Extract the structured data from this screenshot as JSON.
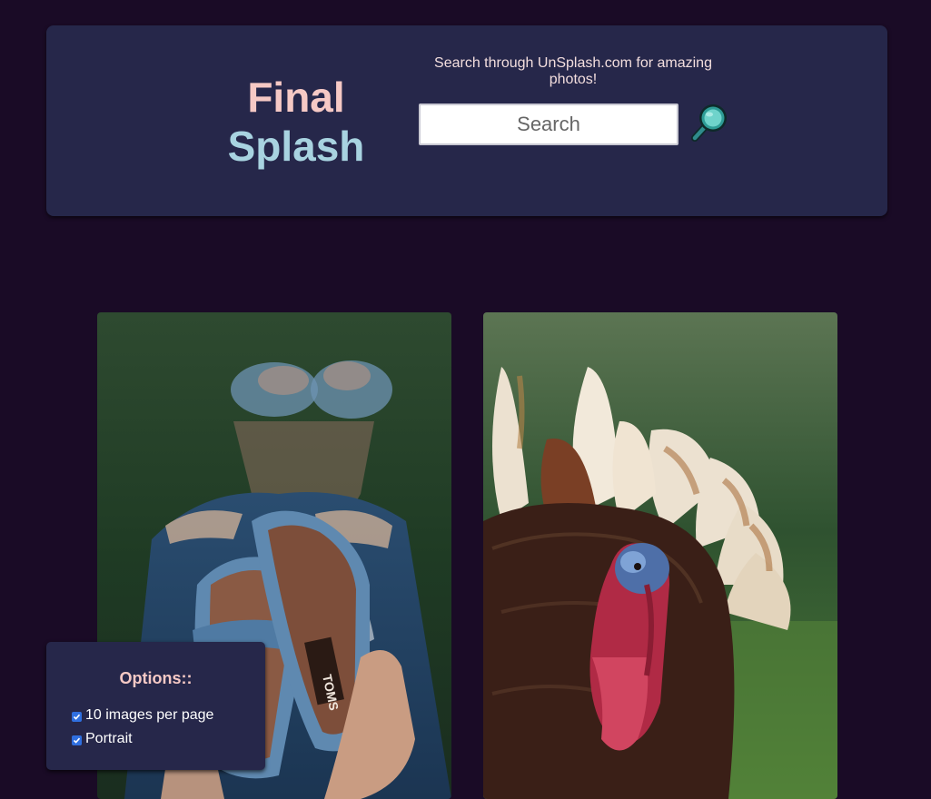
{
  "header": {
    "logo_line1": "Final",
    "logo_line2": "Splash",
    "tagline": "Search through UnSplash.com for amazing photos!",
    "search_placeholder": "Search",
    "search_button_icon": "magnifier-icon"
  },
  "gallery": {
    "images": [
      {
        "subject": "blue sandals held over ripped jeans"
      },
      {
        "subject": "wild turkey with fanned tail"
      }
    ]
  },
  "options": {
    "title": "Options::",
    "items": [
      {
        "label": "10 images per page",
        "checked": true
      },
      {
        "label": "Portrait",
        "checked": true
      }
    ]
  },
  "colors": {
    "background": "#1a0b26",
    "card": "#26274a",
    "logo_pink": "#f6c9c5",
    "logo_blue": "#a8d3e0",
    "checkbox_blue": "#2f6fe0"
  }
}
